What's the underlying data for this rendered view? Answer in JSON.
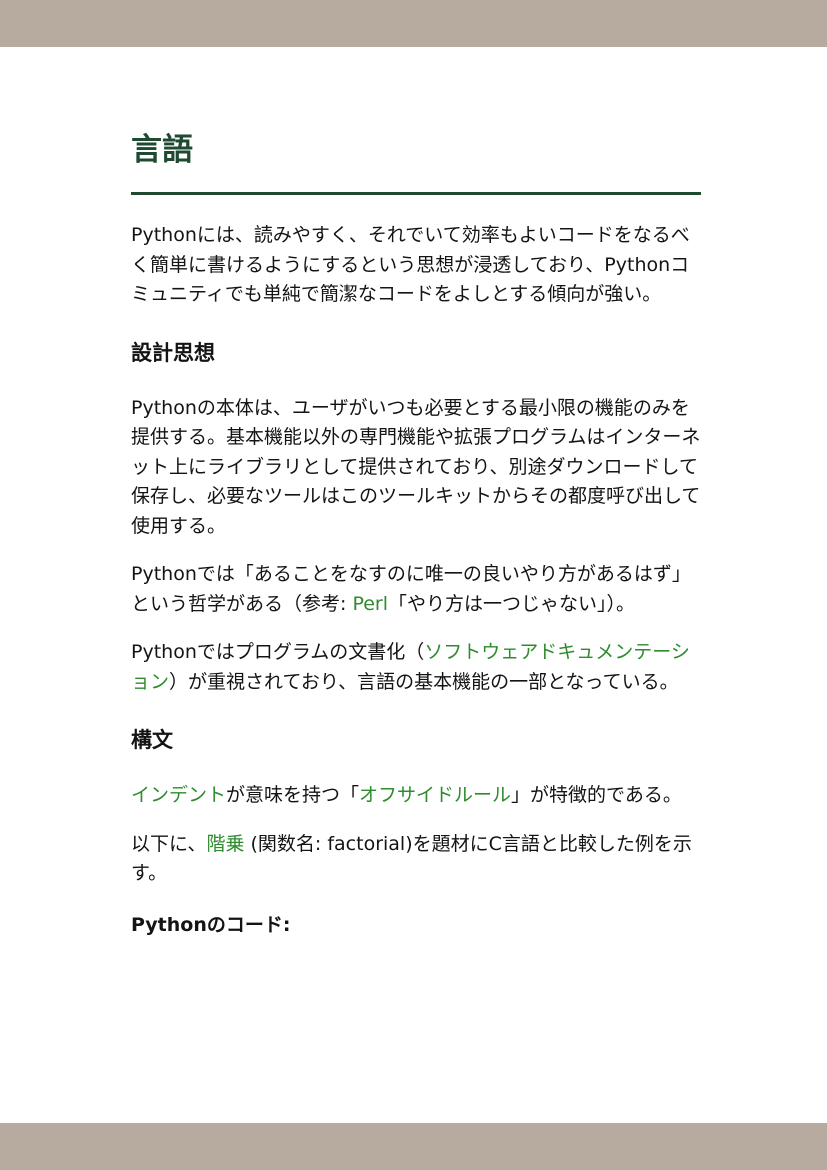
{
  "colors": {
    "band": "#b6ab9e",
    "heading": "#1f4a30",
    "link": "#2e8b2e",
    "text": "#141414"
  },
  "title": "言語",
  "intro": "Pythonには、読みやすく、それでいて効率もよいコードをなるべく簡単に書けるようにするという思想が浸透しており、Pythonコミュニティでも単純で簡潔なコードをよしとする傾向が強い。",
  "design": {
    "heading": "設計思想",
    "p1": "Pythonの本体は、ユーザがいつも必要とする最小限の機能のみを提供する。基本機能以外の専門機能や拡張プログラムはインターネット上にライブラリとして提供されており、別途ダウンロードして保存し、必要なツールはこのツールキットからその都度呼び出して使用する。",
    "p2": {
      "before": "Pythonでは「あることをなすのに唯一の良いやり方があるはず」という哲学がある（参考: ",
      "link": "Perl",
      "after": "「やり方は一つじゃない」）。"
    },
    "p3": {
      "before": "Pythonではプログラムの文書化（",
      "link": "ソフトウェアドキュメンテーション",
      "after": "）が重視されており、言語の基本機能の一部となっている。"
    }
  },
  "syntax": {
    "heading": "構文",
    "p1": {
      "link1": "インデント",
      "middle": "が意味を持つ「",
      "link2": "オフサイドルール",
      "after": "」が特徴的である。"
    },
    "p2": {
      "before": "以下に、",
      "link": "階乗",
      "after": " (関数名: factorial)を題材にC言語と比較した例を示す。"
    },
    "code_label": "Pythonのコード:"
  }
}
